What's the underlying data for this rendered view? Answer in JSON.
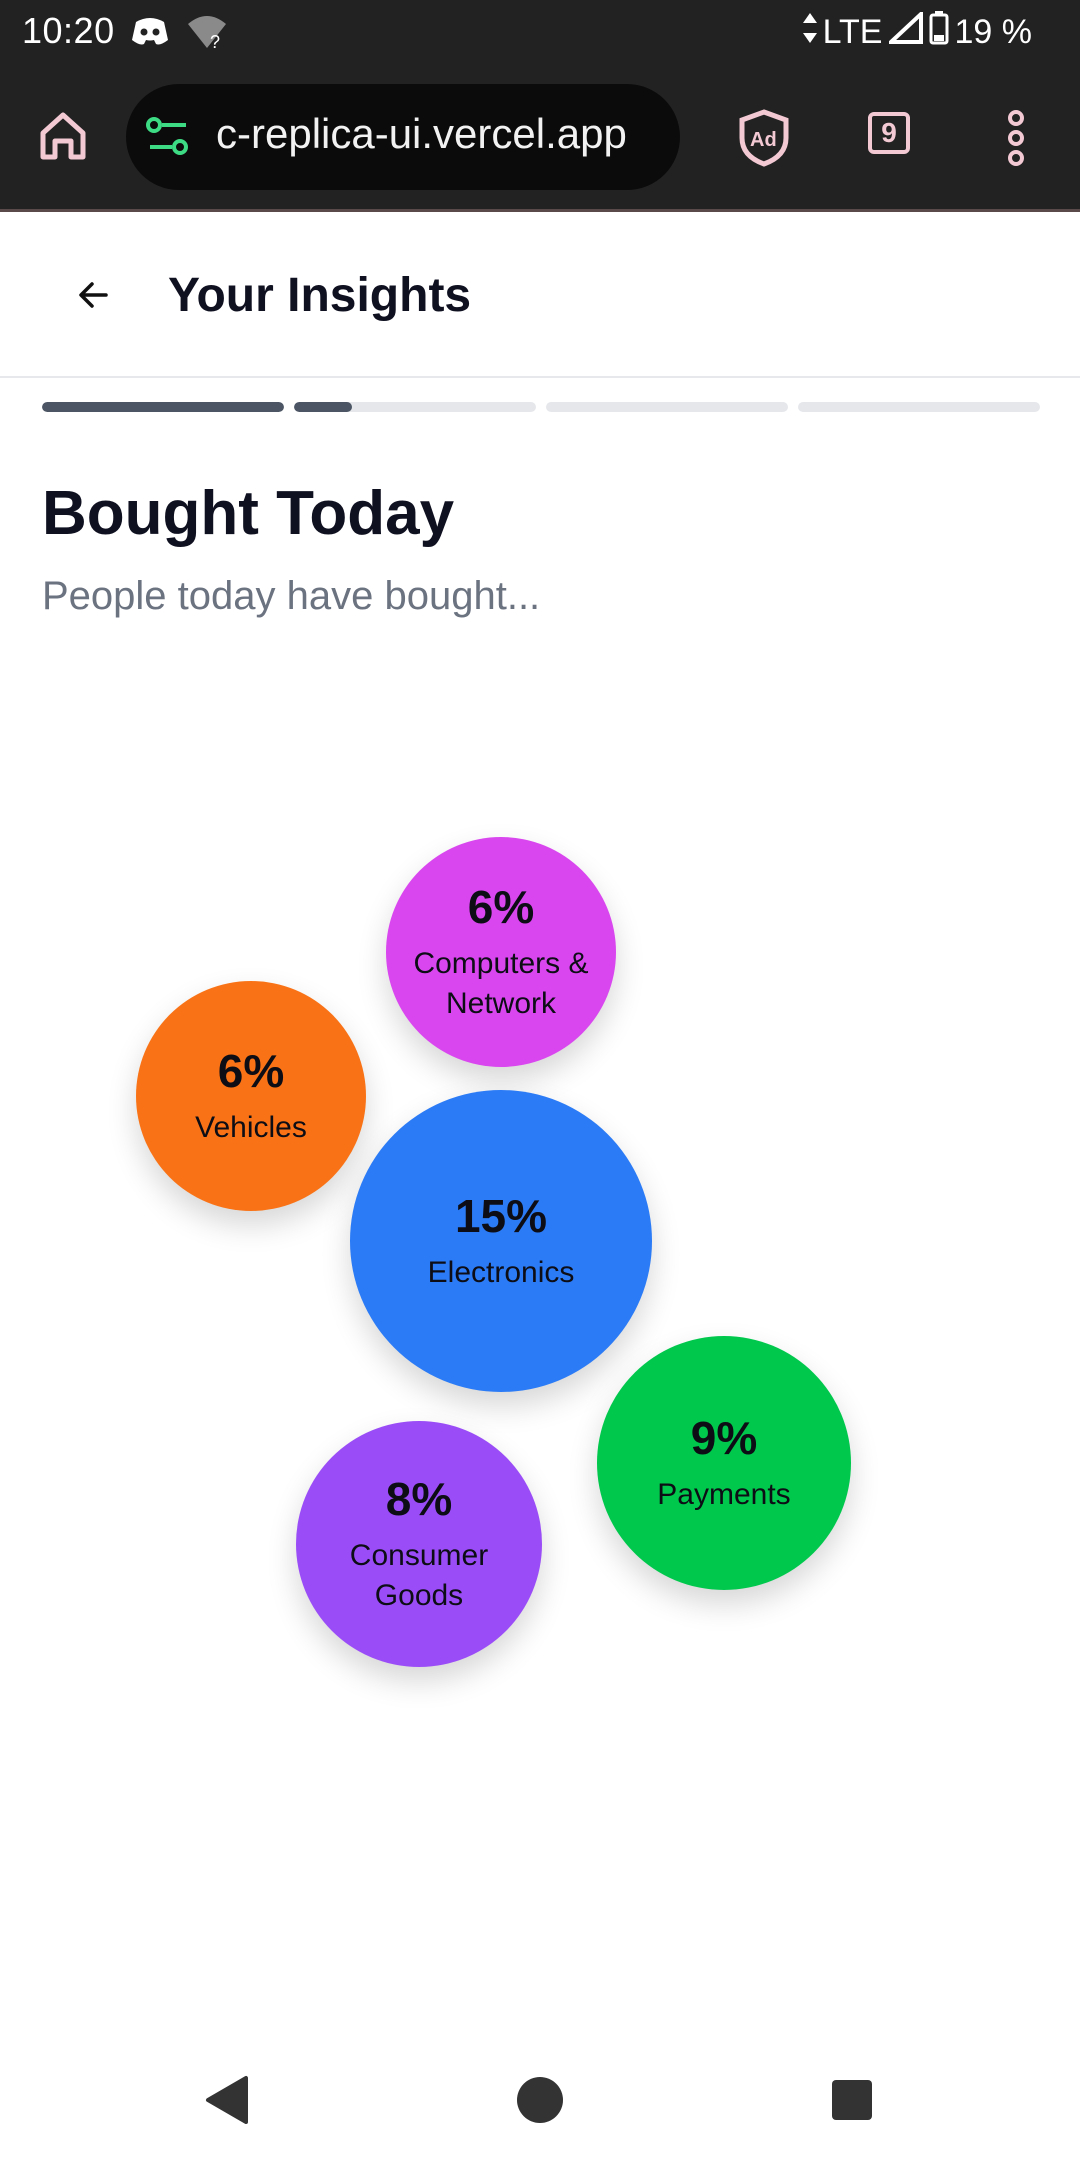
{
  "status_bar": {
    "time": "10:20",
    "network": "LTE",
    "battery": "19 %",
    "icons": [
      "discord-icon",
      "wifi-question-icon",
      "data-arrows-icon",
      "signal-icon",
      "battery-icon"
    ]
  },
  "browser": {
    "url": "c-replica-ui.vercel.app",
    "tab_count": "9",
    "icons": [
      "home-icon",
      "site-settings-icon",
      "ad-block-icon",
      "tabs-icon",
      "more-vert-icon"
    ]
  },
  "header": {
    "title": "Your Insights"
  },
  "progress": [
    {
      "fill": 1.0
    },
    {
      "fill": 0.24
    },
    {
      "fill": 0.0
    },
    {
      "fill": 0.0
    }
  ],
  "section": {
    "title": "Bought Today",
    "subtitle": "People today have bought..."
  },
  "bubbles": [
    {
      "key": "computers",
      "percent": "6%",
      "label": "Computers &\nNetwork",
      "color": "#d946ef"
    },
    {
      "key": "vehicles",
      "percent": "6%",
      "label": "Vehicles",
      "color": "#f97316"
    },
    {
      "key": "electronics",
      "percent": "15%",
      "label": "Electronics",
      "color": "#2b7bf6"
    },
    {
      "key": "payments",
      "percent": "9%",
      "label": "Payments",
      "color": "#00c84d"
    },
    {
      "key": "consumer",
      "percent": "8%",
      "label": "Consumer\nGoods",
      "color": "#9a4df7"
    }
  ],
  "nav": [
    "back-triangle-icon",
    "home-circle-icon",
    "recents-square-icon"
  ]
}
